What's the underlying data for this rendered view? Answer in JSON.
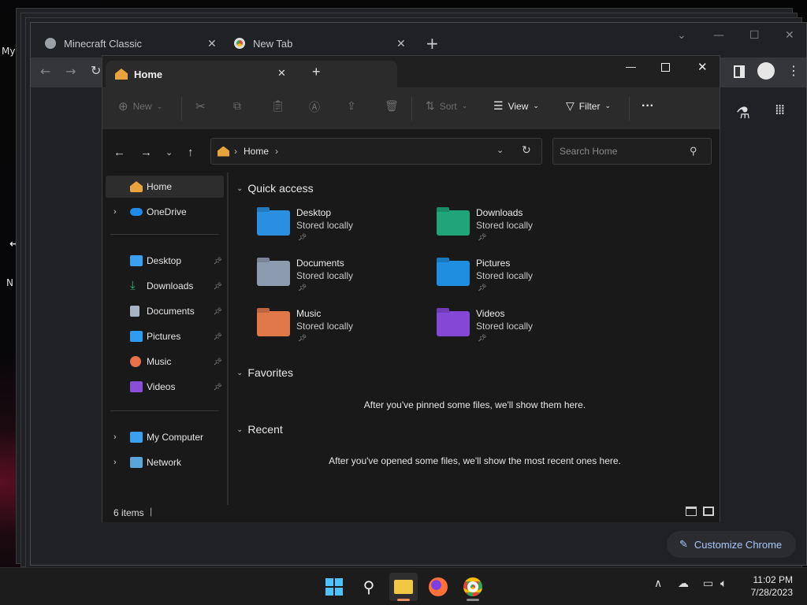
{
  "desktop": {
    "icons": [
      "My",
      "N"
    ]
  },
  "chrome": {
    "tabs": [
      {
        "label": "Minecraft Classic",
        "favicon": "globe-icon"
      },
      {
        "label": "New Tab",
        "favicon": "chrome-icon"
      }
    ],
    "new_tab_symbol": "+",
    "customize_label": "Customize Chrome"
  },
  "explorer": {
    "tab_title": "Home",
    "new_tab_symbol": "+",
    "commands": {
      "new": "New",
      "sort": "Sort",
      "view": "View",
      "filter": "Filter",
      "more": "···"
    },
    "address": {
      "crumb": "Home"
    },
    "search_placeholder": "Search Home",
    "nav": {
      "home": "Home",
      "onedrive": "OneDrive",
      "pinned": [
        {
          "label": "Desktop",
          "color": "#3aa0f0"
        },
        {
          "label": "Downloads",
          "color": "#2bb673"
        },
        {
          "label": "Documents",
          "color": "#a8b4c4"
        },
        {
          "label": "Pictures",
          "color": "#2e9cf0"
        },
        {
          "label": "Music",
          "color": "#e8734a"
        },
        {
          "label": "Videos",
          "color": "#8a4fd8"
        }
      ],
      "my_computer": "My Computer",
      "network": "Network"
    },
    "sections": {
      "quick_access": "Quick access",
      "favorites": "Favorites",
      "recent": "Recent"
    },
    "quick_access_items": [
      {
        "name": "Desktop",
        "sub": "Stored locally",
        "color": "#2a8fe0"
      },
      {
        "name": "Downloads",
        "sub": "Stored locally",
        "color": "#20a57a"
      },
      {
        "name": "Documents",
        "sub": "Stored locally",
        "color": "#8d9bb0"
      },
      {
        "name": "Pictures",
        "sub": "Stored locally",
        "color": "#1f8ee0"
      },
      {
        "name": "Music",
        "sub": "Stored locally",
        "color": "#e0784a"
      },
      {
        "name": "Videos",
        "sub": "Stored locally",
        "color": "#8447d6"
      }
    ],
    "favorites_empty": "After you've pinned some files, we'll show them here.",
    "recent_empty": "After you've opened some files, we'll show the most recent ones here.",
    "status": "6 items"
  },
  "taskbar": {
    "time": "11:02 PM",
    "date": "7/28/2023"
  }
}
